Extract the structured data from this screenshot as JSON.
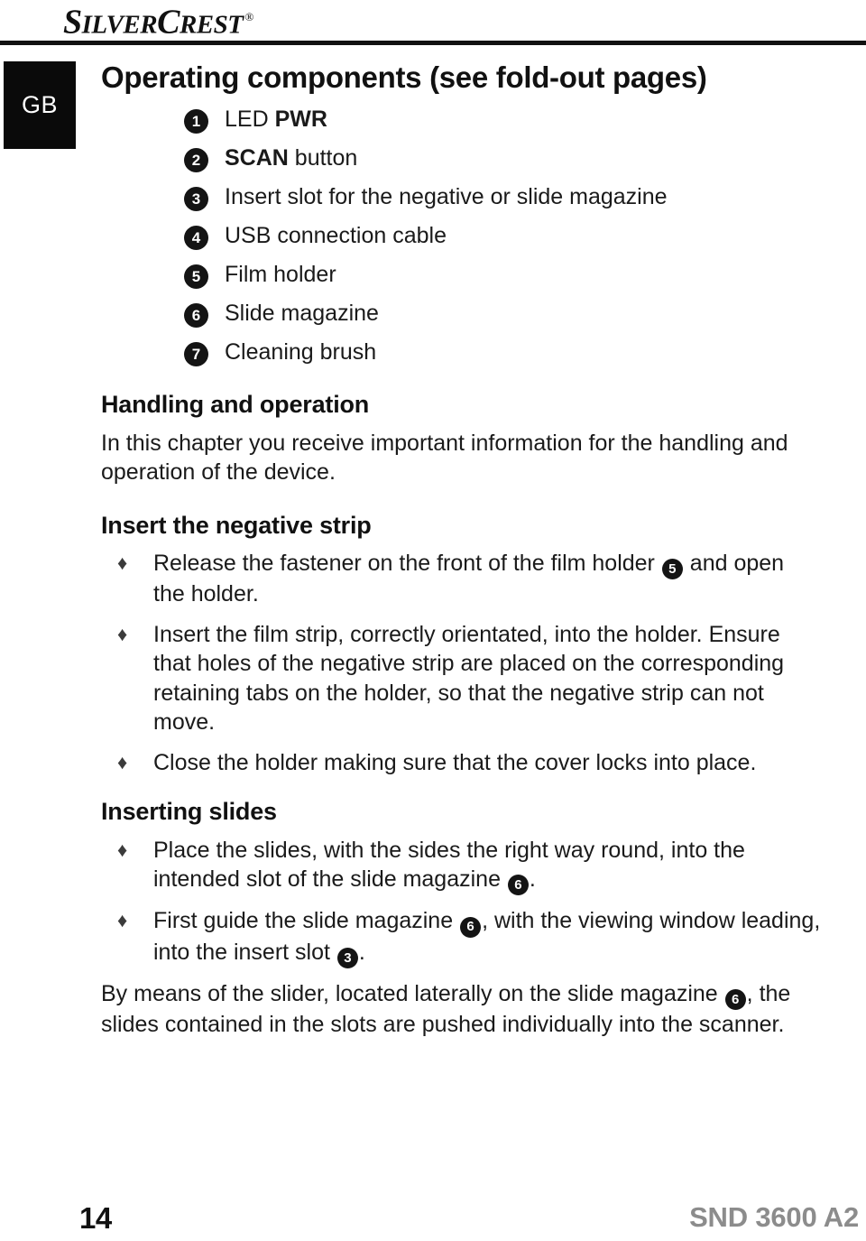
{
  "brand": {
    "name_part1": "S",
    "name_part2": "ILVER",
    "name_part3": "C",
    "name_part4": "REST",
    "registered_mark": "®"
  },
  "language_badge": "GB",
  "sections": {
    "operating_components": {
      "title": "Operating components (see fold-out pages)",
      "items": [
        {
          "number": "1",
          "text_plain": "LED ",
          "text_bold": "PWR",
          "tail": ""
        },
        {
          "number": "2",
          "text_plain": "",
          "text_bold": "SCAN",
          "tail": " button"
        },
        {
          "number": "3",
          "text_plain": "Insert slot for the negative or slide magazine",
          "text_bold": "",
          "tail": ""
        },
        {
          "number": "4",
          "text_plain": "USB connection cable",
          "text_bold": "",
          "tail": ""
        },
        {
          "number": "5",
          "text_plain": "Film holder",
          "text_bold": "",
          "tail": ""
        },
        {
          "number": "6",
          "text_plain": "Slide magazine",
          "text_bold": "",
          "tail": ""
        },
        {
          "number": "7",
          "text_plain": "Cleaning brush",
          "text_bold": "",
          "tail": ""
        }
      ]
    },
    "handling_and_operation": {
      "title": "Handling and operation",
      "intro": "In this chapter you receive important information for the handling and operation of the device."
    },
    "insert_negative_strip": {
      "title": "Insert the negative strip",
      "bullets": [
        {
          "marker": "♦",
          "pre": "Release the fastener on the front of the film holder ",
          "badge": "5",
          "post": " and open the holder."
        },
        {
          "marker": "♦",
          "pre": "Insert the film strip, correctly orientated, into the holder. Ensure that holes of the negative strip are placed on the corresponding retaining tabs on the holder, so that the negative strip can not move.",
          "badge": "",
          "post": ""
        },
        {
          "marker": "♦",
          "pre": "Close the holder making sure that the cover locks into place.",
          "badge": "",
          "post": ""
        }
      ]
    },
    "inserting_slides": {
      "title": "Inserting slides",
      "bullets": [
        {
          "marker": "♦",
          "pre": "Place the slides, with the sides the right way round, into the intended slot of the slide magazine ",
          "badge": "6",
          "post": "."
        },
        {
          "marker": "♦",
          "pre": "First guide the slide magazine ",
          "badge": "6",
          "mid": ", with the viewing window leading, into the insert slot ",
          "badge2": "3",
          "post": "."
        }
      ],
      "closing_paragraph": {
        "pre": "By means of the slider, located laterally on the slide magazine ",
        "badge": "6",
        "post": ", the slides contained in the slots are pushed individually into the scanner."
      }
    }
  },
  "footer": {
    "page_number": "14",
    "model": "SND 3600 A2"
  },
  "colors": {
    "text": "#1a1a1a",
    "badge_bg": "#141414",
    "badge_fg": "#ffffff",
    "footer_model": "#8c8c8c",
    "rule": "#111111"
  }
}
